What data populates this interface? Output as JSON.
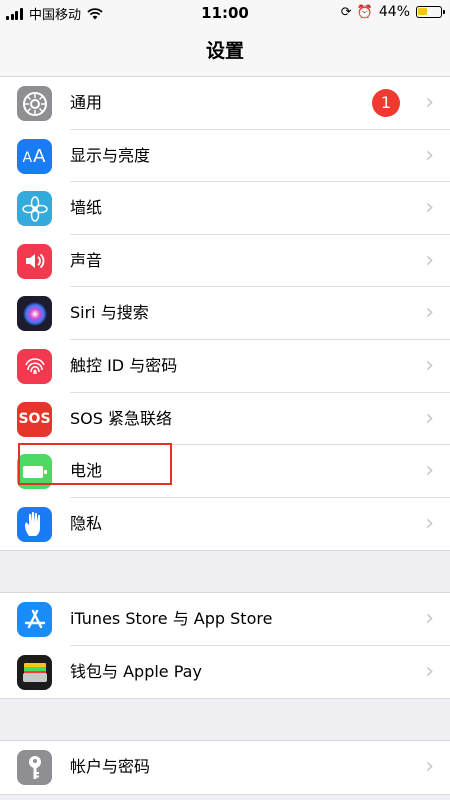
{
  "status_bar": {
    "carrier": "中国移动",
    "time": "11:00",
    "battery_percent": "44%",
    "battery_level": 0.44,
    "battery_color": "#f5c518"
  },
  "nav": {
    "title": "设置"
  },
  "group1": [
    {
      "label": "通用",
      "icon": "gear-icon",
      "color": "#8e8e93",
      "badge": "1"
    },
    {
      "label": "显示与亮度",
      "icon": "text-size-icon",
      "color": "#1a7cf5"
    },
    {
      "label": "墙纸",
      "icon": "flower-icon",
      "color": "#35aadc"
    },
    {
      "label": "声音",
      "icon": "speaker-icon",
      "color": "#f2394f"
    },
    {
      "label": "Siri 与搜索",
      "icon": "siri-icon",
      "color": "#1c1c2e"
    },
    {
      "label": "触控 ID 与密码",
      "icon": "fingerprint-icon",
      "color": "#f2394f"
    },
    {
      "label": "SOS 紧急联络",
      "icon": "sos-icon",
      "color": "#e6352b",
      "icon_text": "SOS"
    },
    {
      "label": "电池",
      "icon": "battery-icon",
      "color": "#4cd964"
    },
    {
      "label": "隐私",
      "icon": "hand-icon",
      "color": "#1a7cf5"
    }
  ],
  "group2": [
    {
      "label": "iTunes Store 与 App Store",
      "icon": "app-store-icon",
      "color": "#1a8cf8"
    },
    {
      "label": "钱包与 Apple Pay",
      "icon": "wallet-icon",
      "color": "#1c1c1c"
    }
  ],
  "group3": [
    {
      "label": "帐户与密码",
      "icon": "key-icon",
      "color": "#8e8e93"
    }
  ],
  "highlight_color": "#e03226"
}
